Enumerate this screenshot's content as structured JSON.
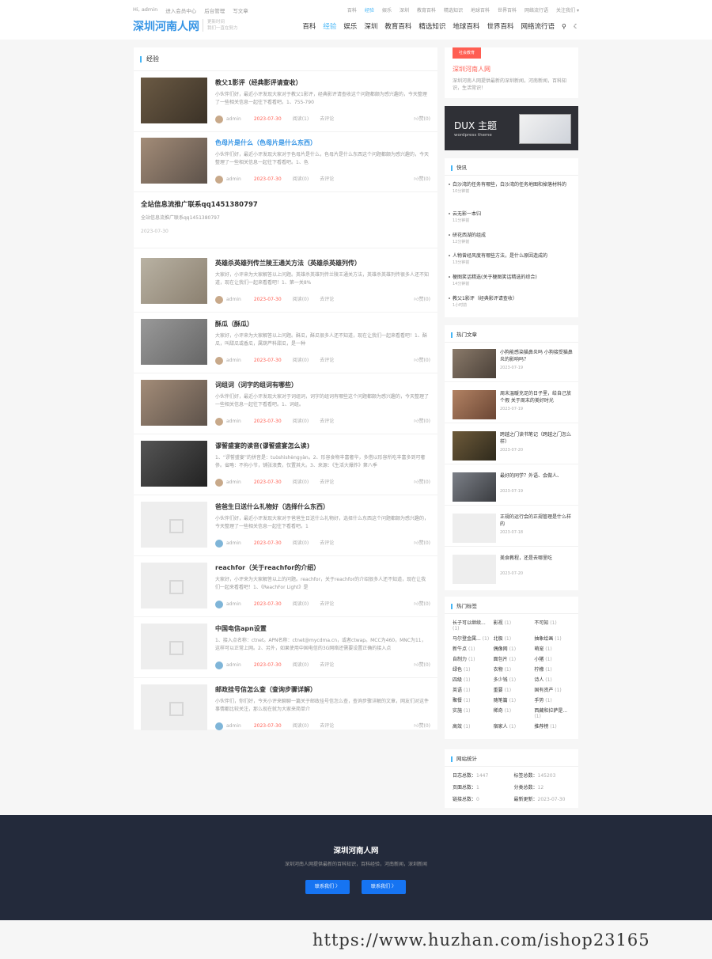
{
  "topbar": {
    "left_links": [
      "Hi, admin",
      "进入会员中心",
      "后台管理",
      "写文章"
    ],
    "right_links": [
      "百科",
      "经验",
      "娱乐",
      "深圳",
      "教育百科",
      "精选知识",
      "地球百科",
      "世界百科",
      "网络流行语",
      "关注我们"
    ]
  },
  "header": {
    "logo": "深圳河南人网",
    "slogan_line1": "更新时间",
    "slogan_line2": "我们一直在努力"
  },
  "nav": {
    "items": [
      "百科",
      "经验",
      "娱乐",
      "深圳",
      "教育百科",
      "精选知识",
      "地球百科",
      "世界百科",
      "网络流行语"
    ],
    "active": "经验"
  },
  "main": {
    "section_title": "经验",
    "posts": [
      {
        "title": "教父1影评（经典影评请查收）",
        "excerpt": "小伙伴们好，最近小评发现大家对于教父1影评，经典影评请查收这个问题都颇为感兴趣的，今天整理了一些相关信息一起往下看看吧。1、755-790",
        "author": "admin",
        "date": "2023-07-30",
        "reads": "阅读(1)",
        "comments": "去评论",
        "likes": "赞(0)"
      },
      {
        "title": "色母片是什么（色母片是什么东西）",
        "excerpt": "小伙伴们好，最近小评发现大家对于色母片是什么，色母片是什么东西这个问题都颇为感兴趣的，今天整理了一些相关信息一起往下看看吧。1、色",
        "author": "admin",
        "date": "2023-07-30",
        "reads": "阅读(0)",
        "comments": "去评论",
        "likes": "赞(0)"
      },
      {
        "title": "英雄杀英雄列传兰陵王通关方法（英雄杀英雄列传）",
        "excerpt": "大家好，小评来为大家解答以上问题。英雄杀英雄列传兰陵王通关方法，英雄杀英雄列传很多人还不知道，现在让我们一起来看看吧！1、第一关8%",
        "author": "admin",
        "date": "2023-07-30",
        "reads": "阅读(0)",
        "comments": "去评论",
        "likes": "赞(0)"
      },
      {
        "title": "酥瓜（酥瓜）",
        "excerpt": "大家好，小评来为大家解答以上问题。酥瓜，酥瓜很多人还不知道，现在让我们一起来看看吧！1、酥瓜，叫甜瓜或香瓜，属葫芦科甜瓜，是一种",
        "author": "admin",
        "date": "2023-07-30",
        "reads": "阅读(0)",
        "comments": "去评论",
        "likes": "赞(0)"
      },
      {
        "title": "词组词（词字的组词有哪些）",
        "excerpt": "小伙伴们好，最近小评发现大家对于词组词，词字的组词有哪些这个问题都颇为感兴趣的，今天整理了一些相关信息一起往下看看吧。1、词组。",
        "author": "admin",
        "date": "2023-07-30",
        "reads": "阅读(0)",
        "comments": "去评论",
        "likes": "赞(0)"
      },
      {
        "title": "谬誓盛宴的读音(谬誓盛宴怎么读)",
        "excerpt": "1、“谬誓盛宴”的拼音是：tuòshìshèngyàn。2、形容食物丰富奢华，多借以形容所吃丰富多到可奢侈。省略：不拘小节，铺张浪费，仅置其大。3、来源：《生活大爆炸》第八季",
        "author": "admin",
        "date": "2023-07-30",
        "reads": "阅读(0)",
        "comments": "去评论",
        "likes": "赞(0)"
      },
      {
        "title": "爸爸生日送什么礼物好（选择什么东西）",
        "excerpt": "小伙伴们好，最近小评发现大家对于爸爸生日送什么礼物好，选择什么东西这个问题都颇为感兴趣的，今天整理了一些相关信息一起往下看看吧。1",
        "author": "admin",
        "date": "2023-07-30",
        "reads": "阅读(0)",
        "comments": "去评论",
        "likes": "赞(0)"
      },
      {
        "title": "reachfor（关于reachfor的介绍）",
        "excerpt": "大家好，小评来为大家解答以上的问题。reachfor，关于reachfor的介绍很多人还不知道，现在让我们一起来看看吧！1、《ReachFor Light》是",
        "author": "admin",
        "date": "2023-07-30",
        "reads": "阅读(0)",
        "comments": "去评论",
        "likes": "赞(0)"
      },
      {
        "title": "中国电信apn设置",
        "excerpt": "1、接入点名称：ctnet。APN名称：ctnet@mycdma.cn，或者ctwap。MCC为460，MNC为11，这样可以正常上网。2、另外，如果使用中国电信的3G网络还需要设置正确的接入点",
        "author": "admin",
        "date": "2023-07-30",
        "reads": "阅读(0)",
        "comments": "去评论",
        "likes": "赞(0)"
      },
      {
        "title": "邮政挂号信怎么查（查询步骤详解）",
        "excerpt": "小伙伴们，你们好，今天小评来聊聊一篇关于邮政挂号信怎么查，查询步骤详解的文章，网友们对这件事情都比较关注，那么现在就为大家来简单介",
        "author": "admin",
        "date": "2023-07-30",
        "reads": "阅读(0)",
        "comments": "去评论",
        "likes": "赞(0)"
      }
    ],
    "notice": {
      "title": "全站信息流推广联系qq1451380797",
      "sub": "全站信息流推广联系qq1451380797",
      "date": "2023-07-30"
    }
  },
  "sidebar": {
    "about": {
      "badge": "社会教育",
      "name": "深圳河南人网",
      "desc": "深圳河南人网提供最新的深圳新闻，河南新闻，百科知识，生活常识！"
    },
    "dux": {
      "big": "DUX 主题",
      "small": "wordpress theme"
    },
    "flash": {
      "title": "快讯",
      "items": [
        {
          "text": "白沙湾的任务有哪些，白沙湾的任务地图和掉落材料的",
          "time": "10分钟前"
        },
        {
          "text": "云无影一本归",
          "time": "11分钟前"
        },
        {
          "text": "研花西湖的组成",
          "time": "12分钟前"
        },
        {
          "text": "人物曾经风度有哪些方法，是什么原因造成的",
          "time": "13分钟前"
        },
        {
          "text": "梗图笑话精选(关于梗图笑话精选的综合)",
          "time": "14分钟前"
        },
        {
          "text": "教父1影评（经典影评请查收）",
          "time": "1小时前"
        }
      ]
    },
    "hot": {
      "title": "热门文章",
      "items": [
        {
          "text": "小狗能感染猫鼻炎吗 小狗接受猫鼻炎的影响吗？",
          "date": "2023-07-19"
        },
        {
          "text": "周末温暖充足的日子里，给自己放个假 关于周末的美好时光",
          "date": "2023-07-19"
        },
        {
          "text": "跨越之门读书笔记（跨越之门怎么样）",
          "date": "2023-07-20"
        },
        {
          "text": "最好的同学？外语、会做人、",
          "date": "2023-07-19"
        },
        {
          "text": "正规的运行会的正规管理是什么样的",
          "date": "2023-07-18"
        },
        {
          "text": "美食教程，还是去哪里吃",
          "date": "2023-07-20"
        }
      ]
    },
    "tags": {
      "title": "热门标签",
      "items": [
        {
          "name": "长子可以继续...",
          "count": "(1)"
        },
        {
          "name": "影视",
          "count": "(1)"
        },
        {
          "name": "不可知",
          "count": "(1)"
        },
        {
          "name": "马尔登金属...",
          "count": "(1)"
        },
        {
          "name": "北极",
          "count": "(1)"
        },
        {
          "name": "抽象绘画",
          "count": "(1)"
        },
        {
          "name": "新牛点",
          "count": "(1)"
        },
        {
          "name": "偶像网",
          "count": "(1)"
        },
        {
          "name": "萌宠",
          "count": "(1)"
        },
        {
          "name": "自制力",
          "count": "(1)"
        },
        {
          "name": "面包片",
          "count": "(1)"
        },
        {
          "name": "小猪",
          "count": "(1)"
        },
        {
          "name": "绿色",
          "count": "(1)"
        },
        {
          "name": "衣物",
          "count": "(1)"
        },
        {
          "name": "柠檬",
          "count": "(1)"
        },
        {
          "name": "四级",
          "count": "(1)"
        },
        {
          "name": "多少钱",
          "count": "(1)"
        },
        {
          "name": "诗人",
          "count": "(1)"
        },
        {
          "name": "英语",
          "count": "(1)"
        },
        {
          "name": "重要",
          "count": "(1)"
        },
        {
          "name": "国有资产",
          "count": "(1)"
        },
        {
          "name": "聚餐",
          "count": "(1)"
        },
        {
          "name": "随笔篇",
          "count": "(1)"
        },
        {
          "name": "手势",
          "count": "(1)"
        },
        {
          "name": "实施",
          "count": "(1)"
        },
        {
          "name": "稀奇",
          "count": "(1)"
        },
        {
          "name": "西藏和拉萨是...",
          "count": "(1)"
        },
        {
          "name": "高效",
          "count": "(1)"
        },
        {
          "name": "宿家人",
          "count": "(1)"
        },
        {
          "name": "推荐榜",
          "count": "(1)"
        }
      ]
    },
    "stats": {
      "title": "网站统计",
      "items": [
        {
          "label": "日志总数：",
          "value": "1447"
        },
        {
          "label": "标签总数：",
          "value": "145203"
        },
        {
          "label": "页面总数：",
          "value": "1"
        },
        {
          "label": "分类总数：",
          "value": "12"
        },
        {
          "label": "链接总数：",
          "value": "0"
        },
        {
          "label": "最新更新：",
          "value": "2023-07-30"
        }
      ]
    }
  },
  "footer": {
    "name": "深圳河南人网",
    "desc": "深圳河南人网提供最新的百科知识，百科经验，河南新闻，深圳新闻",
    "btn1": "联系我们 〉",
    "btn2": "联系我们 〉",
    "watermark": "https://www.huzhan.com/ishop23165"
  },
  "colors": {
    "accent": "#45b6f7",
    "logo": "#3594e5",
    "date": "#ff5e52",
    "footer_bg": "#232a3b",
    "button": "#1674f2"
  }
}
